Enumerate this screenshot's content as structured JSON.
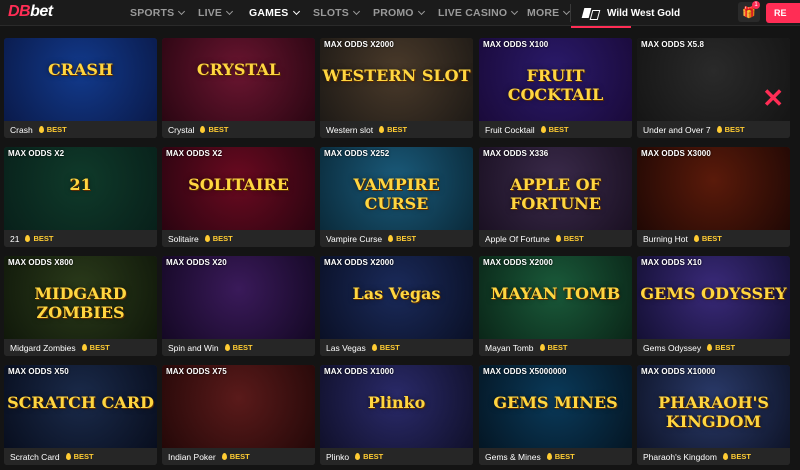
{
  "header": {
    "logo_db": "DB",
    "logo_bet": "bet",
    "nav": [
      {
        "label": "SPORTS"
      },
      {
        "label": "LIVE"
      },
      {
        "label": "GAMES"
      },
      {
        "label": "SLOTS"
      },
      {
        "label": "PROMO"
      },
      {
        "label": "LIVE CASINO"
      },
      {
        "label": "MORE"
      }
    ],
    "provider_label": "Wild West Gold",
    "gift_badge": "1",
    "register_label": "RE"
  },
  "best_label": "BEST",
  "games": [
    {
      "name": "Crash",
      "odds": "",
      "art_title": "CRASH",
      "c1": "#123a8c",
      "c2": "#0a1a4a"
    },
    {
      "name": "Crystal",
      "odds": "",
      "art_title": "CRYSTAL",
      "c1": "#6a1530",
      "c2": "#2a0612"
    },
    {
      "name": "Western slot",
      "odds": "MAX ODDS X2000",
      "art_title": "WESTERN SLOT",
      "c1": "#4a3a2a",
      "c2": "#1e1a16"
    },
    {
      "name": "Fruit Cocktail",
      "odds": "MAX ODDS X100",
      "art_title": "FRUIT COCKTAIL",
      "c1": "#2a1a6a",
      "c2": "#1a0a3a"
    },
    {
      "name": "Under and Over 7",
      "odds": "MAX ODDS X5.8",
      "art_title": "",
      "c1": "#2a2a2a",
      "c2": "#151515"
    },
    {
      "name": "21",
      "odds": "MAX ODDS X2",
      "art_title": "21",
      "c1": "#0f3a2a",
      "c2": "#08201a"
    },
    {
      "name": "Solitaire",
      "odds": "MAX ODDS X2",
      "art_title": "SOLITAIRE",
      "c1": "#6a0a20",
      "c2": "#2a0410"
    },
    {
      "name": "Vampire Curse",
      "odds": "MAX ODDS X252",
      "art_title": "VAMPIRE CURSE",
      "c1": "#1a5a7a",
      "c2": "#0a2a3a"
    },
    {
      "name": "Apple Of Fortune",
      "odds": "MAX ODDS X336",
      "art_title": "APPLE OF FORTUNE",
      "c1": "#3a2a4a",
      "c2": "#1a1022"
    },
    {
      "name": "Burning Hot",
      "odds": "MAX ODDS X3000",
      "art_title": "",
      "c1": "#5a1a0a",
      "c2": "#200804"
    },
    {
      "name": "Midgard Zombies",
      "odds": "MAX ODDS X800",
      "art_title": "MIDGARD ZOMBIES",
      "c1": "#2a3a1a",
      "c2": "#10180a"
    },
    {
      "name": "Spin and Win",
      "odds": "MAX ODDS X20",
      "art_title": "",
      "c1": "#3a1a5a",
      "c2": "#140824"
    },
    {
      "name": "Las Vegas",
      "odds": "MAX ODDS X2000",
      "art_title": "Las Vegas",
      "c1": "#1a2a5a",
      "c2": "#0a1026"
    },
    {
      "name": "Mayan Tomb",
      "odds": "MAX ODDS X2000",
      "art_title": "MAYAN TOMB",
      "c1": "#1a5a3a",
      "c2": "#0a2618"
    },
    {
      "name": "Gems Odyssey",
      "odds": "MAX ODDS X10",
      "art_title": "GEMS ODYSSEY",
      "c1": "#3a2a7a",
      "c2": "#141034"
    },
    {
      "name": "Scratch Card",
      "odds": "MAX ODDS X50",
      "art_title": "SCRATCH CARD",
      "c1": "#1a2a4a",
      "c2": "#080e1e"
    },
    {
      "name": "Indian Poker",
      "odds": "MAX ODDS X75",
      "art_title": "",
      "c1": "#5a1a1a",
      "c2": "#240808"
    },
    {
      "name": "Plinko",
      "odds": "MAX ODDS X1000",
      "art_title": "Plinko",
      "c1": "#2a2a6a",
      "c2": "#10102a"
    },
    {
      "name": "Gems & Mines",
      "odds": "MAX ODDS X5000000",
      "art_title": "GEMS MINES",
      "c1": "#0a3a5a",
      "c2": "#041624"
    },
    {
      "name": "Pharaoh's Kingdom",
      "odds": "MAX ODDS X10000",
      "art_title": "PHARAOH'S KINGDOM",
      "c1": "#2a3a6a",
      "c2": "#0e1428"
    }
  ]
}
